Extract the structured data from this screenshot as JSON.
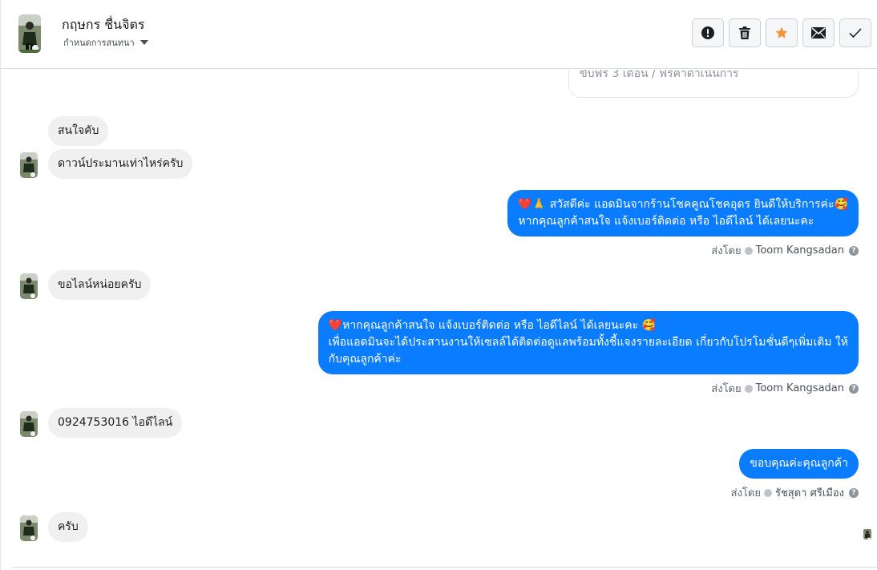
{
  "header": {
    "name": "กฤษกร ชื่นจิตร",
    "subtitle": "กำหนดการสนทนา",
    "actions": [
      {
        "name": "spam-button",
        "icon": "exclamation-icon"
      },
      {
        "name": "delete-button",
        "icon": "trash-icon"
      },
      {
        "name": "star-button",
        "icon": "star-icon",
        "color": "#f7923a"
      },
      {
        "name": "mark-unread-button",
        "icon": "envelope-icon"
      },
      {
        "name": "done-button",
        "icon": "check-icon"
      }
    ]
  },
  "thread": {
    "previous_card_text": "ขับฟรี 3 เดือน / ฟรีค่าดำเนินการ",
    "messages": [
      {
        "direction": "in",
        "text": "สนใจคับ"
      },
      {
        "direction": "in",
        "text": "ดาวน์ประมานเท่าไหร่ครับ"
      },
      {
        "direction": "out",
        "lines": [
          "❤️🙏 สวัสดีค่ะ แอดมินจากร้านโชคคูณโชคอุดร ยินดีให้บริการค่ะ🥰",
          "หากคุณลูกค้าสนใจ แจ้งเบอร์ติดต่อ หรือ ไอดีไลน์ ได้เลยนะคะ"
        ],
        "sent_by_label": "ส่งโดย",
        "agent": "Toom Kangsadan"
      },
      {
        "direction": "in",
        "text": "ขอไลน์หน่อยครับ"
      },
      {
        "direction": "out",
        "lines": [
          "❤️หากคุณลูกค้าสนใจ แจ้งเบอร์ติดต่อ หรือ ไอดีไลน์ ได้เลยนะคะ 🥰",
          "เพื่อแอดมินจะได้ประสานงานให้เซลล์ได้ติดต่อดูแลพร้อมทั้งชี้แจงรายละเอียด เกี่ยวกับโปรโมชั่นดีๆเพิ่มเติม ให้",
          "กับคุณลูกค้าค่ะ"
        ],
        "sent_by_label": "ส่งโดย",
        "agent": "Toom Kangsadan"
      },
      {
        "direction": "in",
        "text": "0924753016 ไอดีไลน์"
      },
      {
        "direction": "out",
        "lines": [
          "ขอบคุณค่ะคุณลูกค้า"
        ],
        "sent_by_label": "ส่งโดย",
        "agent": "รัชสุดา ศรีเมือง"
      },
      {
        "direction": "in",
        "text": "ครับ"
      }
    ]
  },
  "colors": {
    "outgoing_bubble": "#0a7cff",
    "incoming_bubble": "#f0f0f0",
    "star_accent": "#f7923a"
  }
}
